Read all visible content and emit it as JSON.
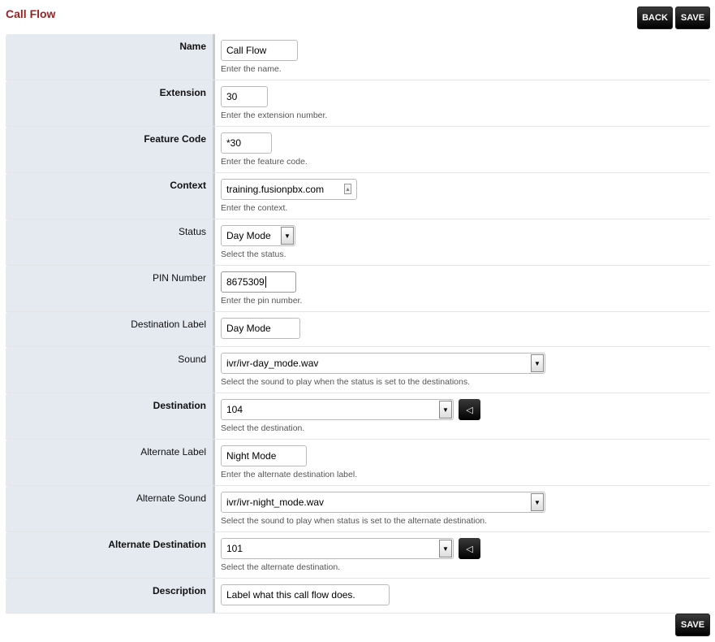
{
  "page": {
    "title": "Call Flow"
  },
  "toolbar": {
    "back_label": "BACK",
    "save_label": "SAVE",
    "bottom_save_label": "SAVE"
  },
  "fields": {
    "name": {
      "label": "Name",
      "value": "Call Flow",
      "desc": "Enter the name."
    },
    "extension": {
      "label": "Extension",
      "value": "30",
      "desc": "Enter the extension number."
    },
    "feature_code": {
      "label": "Feature Code",
      "value": "*30",
      "desc": "Enter the feature code."
    },
    "context": {
      "label": "Context",
      "value": "training.fusionpbx.com",
      "desc": "Enter the context."
    },
    "status": {
      "label": "Status",
      "value": "Day Mode",
      "desc": "Select the status."
    },
    "pin": {
      "label": "PIN Number",
      "value": "8675309",
      "desc": "Enter the pin number."
    },
    "dest_label": {
      "label": "Destination Label",
      "value": "Day Mode"
    },
    "sound": {
      "label": "Sound",
      "value": "ivr/ivr-day_mode.wav",
      "desc": "Select the sound to play when the status is set to the destinations."
    },
    "destination": {
      "label": "Destination",
      "value": "104",
      "desc": "Select the destination."
    },
    "alt_label": {
      "label": "Alternate Label",
      "value": "Night Mode",
      "desc": "Enter the alternate destination label."
    },
    "alt_sound": {
      "label": "Alternate Sound",
      "value": "ivr/ivr-night_mode.wav",
      "desc": "Select the sound to play when status is set to the alternate destination."
    },
    "alt_destination": {
      "label": "Alternate Destination",
      "value": "101",
      "desc": "Select the alternate destination."
    },
    "description": {
      "label": "Description",
      "value": "Label what this call flow does."
    }
  }
}
